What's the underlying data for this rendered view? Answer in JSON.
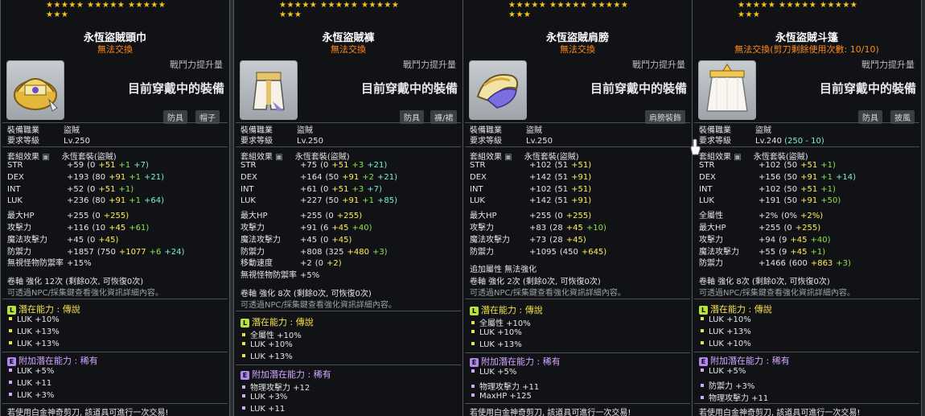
{
  "items": [
    {
      "stars_row1": "★★★★★ ★★★★★ ★★★★★",
      "stars_row2": "★★★",
      "name": "永恆盜賊頭巾",
      "tradeable": "無法交換",
      "power_label": "戰鬥力提升量",
      "equipped_label": "目前穿戴中的裝備",
      "categories": [
        "防具",
        "帽子"
      ],
      "job_label": "裝備職業",
      "job_value": "盜賊",
      "level_label": "要求等級",
      "level_value": "Lv.250",
      "set_label": "套組效果",
      "set_value": "永恆套裝(盜賊)",
      "stats": [
        {
          "label": "STR",
          "total": "+59",
          "open": "(0",
          "p1": "+51",
          "p2": "+1",
          "p3": "+7)"
        },
        {
          "label": "DEX",
          "total": "+193",
          "open": "(80",
          "p1": "+91",
          "p2": "+1",
          "p3": "+21)"
        },
        {
          "label": "INT",
          "total": "+52",
          "open": "(0",
          "p1": "+51",
          "p2": "+1)",
          "p3": ""
        },
        {
          "label": "LUK",
          "total": "+236",
          "open": "(80",
          "p1": "+91",
          "p2": "+1",
          "p3": "+64)"
        },
        {
          "label": "最大HP",
          "total": "+255",
          "open": "(0",
          "p1": "+255)",
          "p2": "",
          "p3": ""
        },
        {
          "label": "攻擊力",
          "total": "+116",
          "open": "(10",
          "p1": "+45",
          "p2": "+61)",
          "p3": ""
        },
        {
          "label": "魔法攻擊力",
          "total": "+45",
          "open": "(0",
          "p1": "+45)",
          "p2": "",
          "p3": ""
        },
        {
          "label": "防禦力",
          "total": "+1857",
          "open": "(750",
          "p1": "+1077",
          "p2": "+6",
          "p3": "+24)"
        },
        {
          "label": "無視怪物防禦率",
          "total": "+15%",
          "open": "",
          "p1": "",
          "p2": "",
          "p3": ""
        }
      ],
      "scroll_line": "卷軸 強化 12次 (剩餘0次, 可恢復0次)",
      "hint_line": "可透過NPC/採集鍵查看強化資訊詳細內容。",
      "potential_title": "潛在能力 : 傳說",
      "potential": [
        "LUK +10%",
        "LUK +13%",
        "LUK +13%"
      ],
      "bonus_title": "附加潛在能力 : 稀有",
      "bonus": [
        "LUK +5%",
        "LUK +11",
        "LUK +3%"
      ],
      "footer": "若使用白金神奇剪刀, 該道具可進行一次交易!"
    },
    {
      "stars_row1": "★★★★★ ★★★★★ ★★★★★",
      "stars_row2": "★★★",
      "name": "永恆盜賊褲",
      "tradeable": "無法交換",
      "power_label": "戰鬥力提升量",
      "equipped_label": "目前穿戴中的裝備",
      "categories": [
        "防具",
        "褲/裙"
      ],
      "job_label": "裝備職業",
      "job_value": "盜賊",
      "level_label": "要求等級",
      "level_value": "Lv.250",
      "set_label": "套組效果",
      "set_value": "永恆套裝(盜賊)",
      "stats": [
        {
          "label": "STR",
          "total": "+75",
          "open": "(0",
          "p1": "+51",
          "p2": "+3",
          "p3": "+21)"
        },
        {
          "label": "DEX",
          "total": "+164",
          "open": "(50",
          "p1": "+91",
          "p2": "+2",
          "p3": "+21)"
        },
        {
          "label": "INT",
          "total": "+61",
          "open": "(0",
          "p1": "+51",
          "p2": "+3",
          "p3": "+7)"
        },
        {
          "label": "LUK",
          "total": "+227",
          "open": "(50",
          "p1": "+91",
          "p2": "+1",
          "p3": "+85)"
        },
        {
          "label": "最大HP",
          "total": "+255",
          "open": "(0",
          "p1": "+255)",
          "p2": "",
          "p3": ""
        },
        {
          "label": "攻擊力",
          "total": "+91",
          "open": "(6",
          "p1": "+45",
          "p2": "+40)",
          "p3": ""
        },
        {
          "label": "魔法攻擊力",
          "total": "+45",
          "open": "(0",
          "p1": "+45)",
          "p2": "",
          "p3": ""
        },
        {
          "label": "防禦力",
          "total": "+808",
          "open": "(325",
          "p1": "+480",
          "p2": "+3)",
          "p3": ""
        },
        {
          "label": "移動速度",
          "total": "+2",
          "open": "(0",
          "p1": "+2)",
          "p2": "",
          "p3": ""
        },
        {
          "label": "無視怪物防禦率",
          "total": "+5%",
          "open": "",
          "p1": "",
          "p2": "",
          "p3": ""
        }
      ],
      "scroll_line": "卷軸 強化 8次 (剩餘0次, 可恢復0次)",
      "hint_line": "可透過NPC/採集鍵查看強化資訊詳細內容。",
      "potential_title": "潛在能力 : 傳說",
      "potential": [
        "全屬性 +10%",
        "LUK +10%",
        "LUK +13%"
      ],
      "bonus_title": "附加潛在能力 : 稀有",
      "bonus": [
        "物理攻擊力 +12",
        "LUK +3%",
        "LUK +11"
      ],
      "footer": ""
    },
    {
      "stars_row1": "★★★★★ ★★★★★ ★★★★★",
      "stars_row2": "★★★",
      "name": "永恆盜賊肩膀",
      "tradeable": "無法交換",
      "power_label": "戰鬥力提升量",
      "equipped_label": "目前穿戴中的裝備",
      "categories": [
        "肩膀裝飾"
      ],
      "job_label": "裝備職業",
      "job_value": "盜賊",
      "level_label": "要求等級",
      "level_value": "Lv.250",
      "set_label": "套組效果",
      "set_value": "永恆套裝(盜賊)",
      "stats": [
        {
          "label": "STR",
          "total": "+102",
          "open": "(51",
          "p1": "+51)",
          "p2": "",
          "p3": ""
        },
        {
          "label": "DEX",
          "total": "+142",
          "open": "(51",
          "p1": "+91)",
          "p2": "",
          "p3": ""
        },
        {
          "label": "INT",
          "total": "+102",
          "open": "(51",
          "p1": "+51)",
          "p2": "",
          "p3": ""
        },
        {
          "label": "LUK",
          "total": "+142",
          "open": "(51",
          "p1": "+91)",
          "p2": "",
          "p3": ""
        },
        {
          "label": "最大HP",
          "total": "+255",
          "open": "(0",
          "p1": "+255)",
          "p2": "",
          "p3": ""
        },
        {
          "label": "攻擊力",
          "total": "+83",
          "open": "(28",
          "p1": "+45",
          "p2": "+10)",
          "p3": ""
        },
        {
          "label": "魔法攻擊力",
          "total": "+73",
          "open": "(28",
          "p1": "+45)",
          "p2": "",
          "p3": ""
        },
        {
          "label": "防禦力",
          "total": "+1095",
          "open": "(450",
          "p1": "+645)",
          "p2": "",
          "p3": ""
        }
      ],
      "extra_line": "追加屬性 無法強化",
      "scroll_line": "卷軸 強化 2次 (剩餘0次, 可恢復0次)",
      "hint_line": "可透過NPC/採集鍵查看強化資訊詳細內容。",
      "potential_title": "潛在能力 : 傳說",
      "potential": [
        "全屬性 +10%",
        "LUK +10%",
        "LUK +13%"
      ],
      "bonus_title": "附加潛在能力 : 稀有",
      "bonus": [
        "LUK +5%",
        "物理攻擊力 +11",
        "MaxHP +125"
      ],
      "footer": "若使用白金神奇剪刀, 該道具可進行一次交易!"
    },
    {
      "stars_row1": "★★★★★ ★★★★★ ★★★★★",
      "stars_row2": "★★★",
      "name": "永恆盜賊斗篷",
      "tradeable": "無法交換",
      "tradeable_extra": "(剪刀剩餘使用次數: 10/10)",
      "power_label": "戰鬥力提升量",
      "equipped_label": "目前穿戴中的裝備",
      "categories": [
        "防具",
        "披風"
      ],
      "job_label": "裝備職業",
      "job_value": "盜賊",
      "level_label": "要求等級",
      "level_value": "Lv.240",
      "level_extra": "(250 - 10)",
      "set_label": "套組效果",
      "set_value": "永恆套裝(盜賊)",
      "stats": [
        {
          "label": "STR",
          "total": "+102",
          "open": "(50",
          "p1": "+51",
          "p2": "+1)",
          "p3": ""
        },
        {
          "label": "DEX",
          "total": "+156",
          "open": "(50",
          "p1": "+91",
          "p2": "+1",
          "p3": "+14)"
        },
        {
          "label": "INT",
          "total": "+102",
          "open": "(50",
          "p1": "+51",
          "p2": "+1)",
          "p3": ""
        },
        {
          "label": "LUK",
          "total": "+191",
          "open": "(50",
          "p1": "+91",
          "p2": "+50)",
          "p3": ""
        },
        {
          "label": "全屬性",
          "total": "+2%",
          "open": "(0%",
          "p1": "+2%)",
          "p2": "",
          "p3": ""
        },
        {
          "label": "最大HP",
          "total": "+255",
          "open": "(0",
          "p1": "+255)",
          "p2": "",
          "p3": ""
        },
        {
          "label": "攻擊力",
          "total": "+94",
          "open": "(9",
          "p1": "+45",
          "p2": "+40)",
          "p3": ""
        },
        {
          "label": "魔法攻擊力",
          "total": "+55",
          "open": "(9",
          "p1": "+45",
          "p2": "+1)",
          "p3": ""
        },
        {
          "label": "防禦力",
          "total": "+1466",
          "open": "(600",
          "p1": "+863",
          "p2": "+3)",
          "p3": ""
        }
      ],
      "scroll_line": "卷軸 強化 8次 (剩餘0次, 可恢復0次)",
      "hint_line": "可透過NPC/採集鍵查看強化資訊詳細內容。",
      "potential_title": "潛在能力 : 傳說",
      "potential": [
        "LUK +10%",
        "LUK +13%",
        "LUK +10%"
      ],
      "bonus_title": "附加潛在能力 : 稀有",
      "bonus": [
        "LUK +5%",
        "防禦力 +3%",
        "物理攻擊力 +11"
      ],
      "footer": "若使用白金神奇剪刀, 該道具可進行一次交易!"
    }
  ],
  "colors": {
    "star": "#f6c51c",
    "title": "#ffffff",
    "untradeable": "#ff8a1c",
    "base": "#fff15a",
    "flame": "#8ce64a",
    "scroll": "#7df0dc",
    "potential": "#f6e04c"
  },
  "icons": [
    "headgear-icon",
    "pants-icon",
    "shoulder-icon",
    "cape-icon",
    "lock-icon",
    "legendary-badge-icon",
    "epic-badge-icon",
    "hand-cursor-icon"
  ],
  "badges": {
    "legendary": "L",
    "epic": "E"
  }
}
